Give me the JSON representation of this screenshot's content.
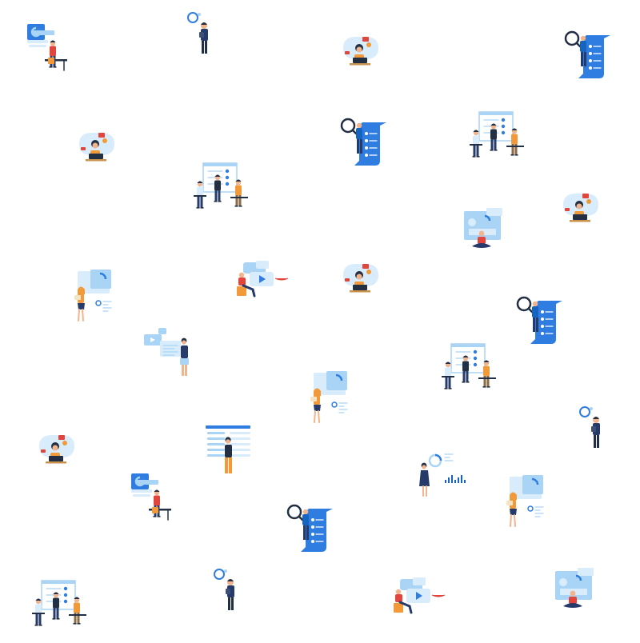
{
  "background": "#ffffff",
  "palette": {
    "blue": "#2f7de1",
    "deep_blue": "#1565c0",
    "light_blue": "#a9d4f5",
    "pale_blue": "#d8ecfb",
    "skin": "#f2b48c",
    "dark": "#233044",
    "orange": "#f29a3a",
    "red": "#e2453c",
    "navy": "#273b6b",
    "wood": "#c9924d"
  },
  "illustrations": [
    {
      "kind": "desk-worker",
      "icon": "person-at-desk-with-dashboard-illustration"
    },
    {
      "kind": "standing-man",
      "icon": "man-holding-tablet-illustration"
    },
    {
      "kind": "laptop-woman",
      "icon": "woman-with-laptop-chat-illustration"
    },
    {
      "kind": "magnifier-doc",
      "icon": "woman-with-magnifier-checklist-illustration"
    },
    {
      "kind": "laptop-woman",
      "icon": "woman-with-laptop-chat-illustration"
    },
    {
      "kind": "magnifier-doc",
      "icon": "woman-with-magnifier-checklist-illustration"
    },
    {
      "kind": "team-board",
      "icon": "team-meeting-board-illustration"
    },
    {
      "kind": "team-board",
      "icon": "team-meeting-board-illustration"
    },
    {
      "kind": "laptop-woman",
      "icon": "woman-with-laptop-chat-illustration"
    },
    {
      "kind": "meditating-dashboard",
      "icon": "meditating-person-dashboard-illustration"
    },
    {
      "kind": "woman-with-chart",
      "icon": "woman-presenting-chart-illustration"
    },
    {
      "kind": "video-sitting",
      "icon": "man-sitting-video-player-illustration"
    },
    {
      "kind": "laptop-woman",
      "icon": "woman-with-laptop-chat-illustration"
    },
    {
      "kind": "magnifier-doc",
      "icon": "woman-with-magnifier-checklist-illustration"
    },
    {
      "kind": "video-standing",
      "icon": "woman-at-video-screen-illustration"
    },
    {
      "kind": "team-board",
      "icon": "team-meeting-board-illustration"
    },
    {
      "kind": "woman-with-chart",
      "icon": "woman-presenting-chart-illustration"
    },
    {
      "kind": "standing-man",
      "icon": "man-holding-tablet-illustration"
    },
    {
      "kind": "laptop-woman",
      "icon": "woman-with-laptop-chat-illustration"
    },
    {
      "kind": "woman-at-board",
      "icon": "woman-at-web-layout-illustration"
    },
    {
      "kind": "woman-analytics",
      "icon": "woman-with-analytics-bars-illustration"
    },
    {
      "kind": "desk-worker",
      "icon": "person-at-desk-with-dashboard-illustration"
    },
    {
      "kind": "woman-with-chart",
      "icon": "woman-presenting-chart-illustration"
    },
    {
      "kind": "magnifier-doc",
      "icon": "woman-with-magnifier-checklist-illustration"
    },
    {
      "kind": "team-board",
      "icon": "team-meeting-board-illustration"
    },
    {
      "kind": "standing-man",
      "icon": "man-holding-tablet-illustration"
    },
    {
      "kind": "video-sitting",
      "icon": "man-sitting-video-player-illustration"
    },
    {
      "kind": "meditating-dashboard",
      "icon": "meditating-person-dashboard-illustration"
    }
  ]
}
